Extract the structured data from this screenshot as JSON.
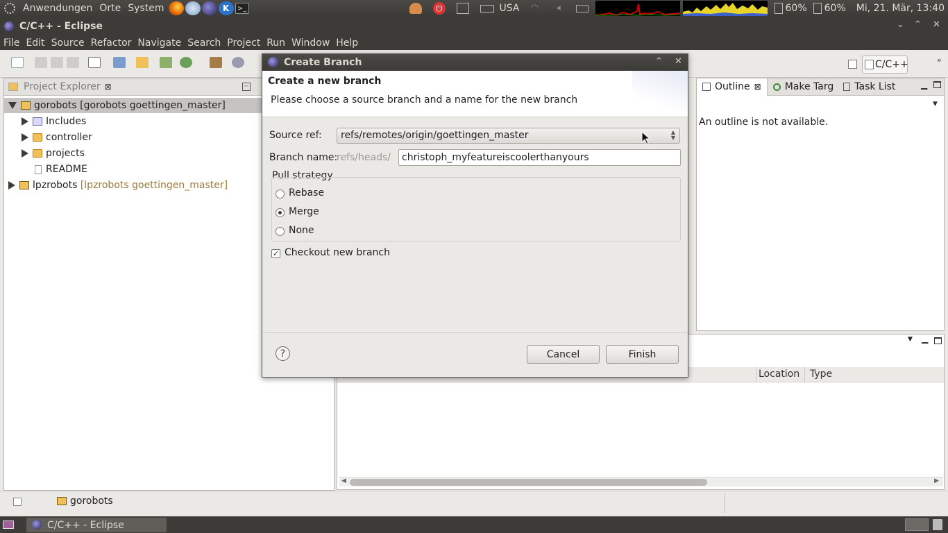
{
  "top_panel": {
    "menus": [
      "Anwendungen",
      "Orte",
      "System"
    ],
    "keyboard_layout": "USA",
    "battery1": "60%",
    "battery2": "60%",
    "clock": "Mi, 21. Mär, 13:40"
  },
  "window": {
    "title": "C/C++ - Eclipse",
    "menu": [
      "File",
      "Edit",
      "Source",
      "Refactor",
      "Navigate",
      "Search",
      "Project",
      "Run",
      "Window",
      "Help"
    ],
    "perspective": "C/C++"
  },
  "project_explorer": {
    "tab_label": "Project Explorer",
    "items": [
      {
        "label": "gorobots",
        "suffix": "[gorobots goettingen_master]"
      },
      {
        "label": "Includes"
      },
      {
        "label": "controller"
      },
      {
        "label": "projects"
      },
      {
        "label": "README"
      },
      {
        "label": "lpzrobots",
        "suffix": "[lpzrobots goettingen_master]"
      }
    ]
  },
  "outline": {
    "tabs": [
      "Outline",
      "Make Targ",
      "Task List"
    ],
    "message": "An outline is not available."
  },
  "problems": {
    "columns": [
      "Location",
      "Type"
    ]
  },
  "status_bar": {
    "selected": "gorobots"
  },
  "taskbar": {
    "window_button": "C/C++ - Eclipse"
  },
  "dialog": {
    "title": "Create Branch",
    "header_title": "Create a new branch",
    "header_message": "Please choose a source branch and a name for the new branch",
    "source_ref_label": "Source ref:",
    "source_ref_value": "refs/remotes/origin/goettingen_master",
    "branch_name_label": "Branch name:",
    "branch_prefix": "refs/heads/",
    "branch_name_value": "christoph_myfeatureiscoolerthanyours",
    "pull_strategy_label": "Pull strategy",
    "pull_options": [
      "Rebase",
      "Merge",
      "None"
    ],
    "pull_selected": "Merge",
    "checkout_label": "Checkout new branch",
    "checkout_checked": true,
    "cancel_label": "Cancel",
    "finish_label": "Finish",
    "help_symbol": "?"
  }
}
